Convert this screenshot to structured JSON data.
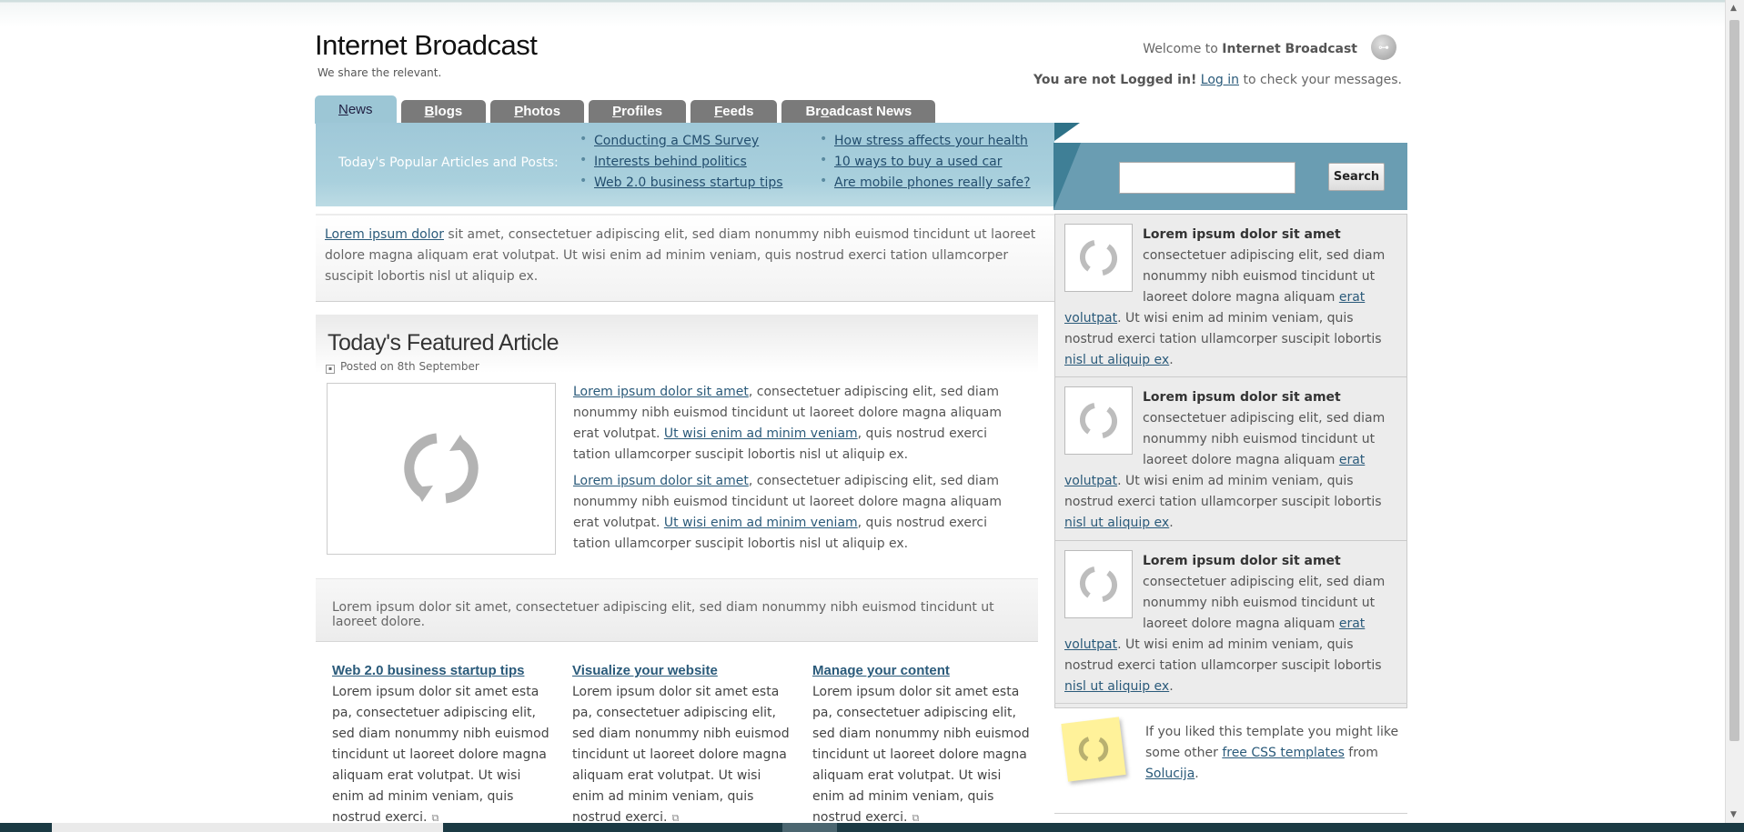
{
  "site": {
    "title": "Internet Broadcast",
    "tagline": "We share the relevant.",
    "welcome_prefix": "Welcome to",
    "welcome_name": "Internet Broadcast",
    "not_logged": "You are not Logged in!",
    "login_link": "Log in",
    "login_suffix": "to check your messages."
  },
  "tabs": [
    {
      "first": "N",
      "rest": "ews",
      "active": true
    },
    {
      "first": "B",
      "rest": "logs"
    },
    {
      "first": "P",
      "rest": "hotos"
    },
    {
      "first": "P",
      "rest": "rofiles"
    },
    {
      "first": "F",
      "rest": "eeds"
    },
    {
      "first": "Br",
      "mid": "o",
      "rest": "adcast News"
    }
  ],
  "popular": {
    "label": "Today's Popular Articles and Posts:",
    "col1": [
      "Conducting a CMS Survey",
      "Interests behind politics",
      "Web 2.0 business startup tips"
    ],
    "col2": [
      "How stress affects your health",
      "10 ways to buy a used car",
      "Are mobile phones really safe?"
    ]
  },
  "intro": {
    "link": "Lorem ipsum dolor",
    "text": " sit amet, consectetuer adipiscing elit, sed diam nonummy nibh euismod tincidunt ut laoreet dolore magna aliquam erat volutpat. Ut wisi enim ad minim veniam, quis nostrud exerci tation ullamcorper suscipit lobortis nisl ut aliquip ex."
  },
  "featured": {
    "title": "Today's Featured Article",
    "posted": "Posted on 8th September",
    "p_link1": "Lorem ipsum dolor sit amet",
    "p_text1": ", consectetuer adipiscing elit, sed diam nonummy nibh euismod tincidunt ut laoreet dolore magna aliquam erat volutpat. ",
    "p_link2": "Ut wisi enim ad minim veniam",
    "p_text2": ", quis nostrud exerci tation ullamcorper suscipit lobortis nisl ut aliquip ex."
  },
  "summary": "Lorem ipsum dolor sit amet, consectetuer adipiscing elit, sed diam nonummy nibh euismod tincidunt ut laoreet dolore.",
  "columns": [
    {
      "title": "Web 2.0 business startup tips",
      "text": "Lorem ipsum dolor sit amet esta pa, consectetuer adipiscing elit, sed diam nonummy nibh euismod tincidunt ut laoreet dolore magna aliquam erat volutpat. Ut wisi enim ad minim veniam, quis nostrud exerci."
    },
    {
      "title": "Visualize your website",
      "text": "Lorem ipsum dolor sit amet esta pa, consectetuer adipiscing elit, sed diam nonummy nibh euismod tincidunt ut laoreet dolore magna aliquam erat volutpat. Ut wisi enim ad minim veniam, quis nostrud exerci."
    },
    {
      "title": "Manage your content",
      "text": "Lorem ipsum dolor sit amet esta pa, consectetuer adipiscing elit, sed diam nonummy nibh euismod tincidunt ut laoreet dolore magna aliquam erat volutpat. Ut wisi enim ad minim veniam, quis nostrud exerci."
    }
  ],
  "search": {
    "button": "Search",
    "value": ""
  },
  "card": {
    "title": "Lorem ipsum dolor sit amet",
    "text1": "consectetuer adipiscing elit, sed diam nonummy nibh euismod tincidunt ut laoreet dolore magna aliquam ",
    "link1": "erat volutpat",
    "text2": ". Ut wisi enim ad minim veniam, quis nostrud exerci tation ullamcorper suscipit lobortis ",
    "link2": "nisl ut aliquip ex",
    "text3": "."
  },
  "promo": {
    "text1": "If you liked this template you might like some other ",
    "link1": "free CSS templates",
    "text2": " from ",
    "link2": "Solucija",
    "text3": "."
  },
  "icons": {
    "key": "key-icon",
    "reload": "reload-icon",
    "calendar": "calendar-icon",
    "external": "external-link-icon"
  },
  "colors": {
    "accent": "#9fc8d8",
    "tab": "#7a7a7a",
    "link": "#2a5a7a",
    "search_panel": "#6a9db2"
  }
}
